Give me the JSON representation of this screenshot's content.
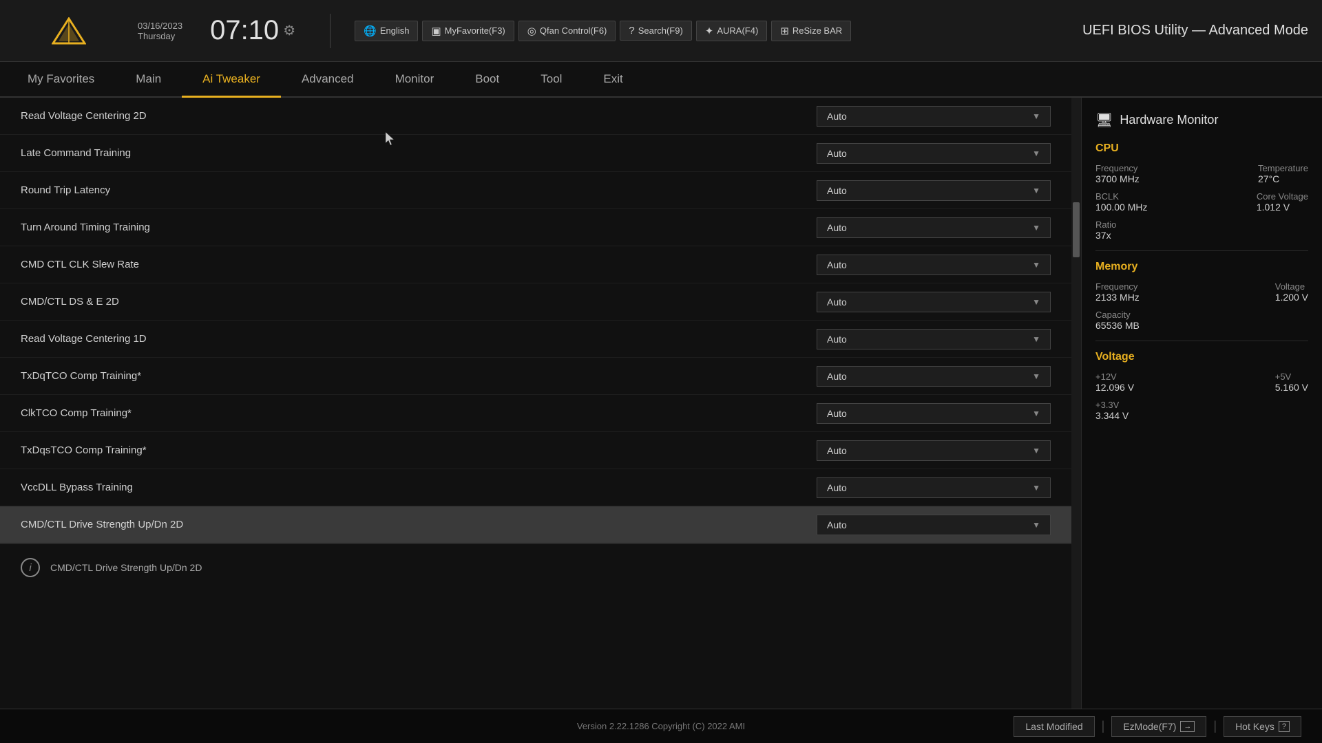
{
  "header": {
    "title": "UEFI BIOS Utility — Advanced Mode",
    "date": "03/16/2023",
    "day": "Thursday",
    "time": "07:10",
    "settings_icon": "⚙",
    "logo_alt": "ASUS"
  },
  "toolbar": {
    "items": [
      {
        "id": "language",
        "icon": "🌐",
        "label": "English"
      },
      {
        "id": "myfavorite",
        "icon": "★",
        "label": "MyFavorite(F3)"
      },
      {
        "id": "qfan",
        "icon": "◎",
        "label": "Qfan Control(F6)"
      },
      {
        "id": "search",
        "icon": "?",
        "label": "Search(F9)"
      },
      {
        "id": "aura",
        "icon": "✦",
        "label": "AURA(F4)"
      },
      {
        "id": "resizebar",
        "icon": "⊞",
        "label": "ReSize BAR"
      }
    ]
  },
  "nav": {
    "items": [
      {
        "id": "my-favorites",
        "label": "My Favorites",
        "active": false
      },
      {
        "id": "main",
        "label": "Main",
        "active": false
      },
      {
        "id": "ai-tweaker",
        "label": "Ai Tweaker",
        "active": true
      },
      {
        "id": "advanced",
        "label": "Advanced",
        "active": false
      },
      {
        "id": "monitor",
        "label": "Monitor",
        "active": false
      },
      {
        "id": "boot",
        "label": "Boot",
        "active": false
      },
      {
        "id": "tool",
        "label": "Tool",
        "active": false
      },
      {
        "id": "exit",
        "label": "Exit",
        "active": false
      }
    ]
  },
  "settings": {
    "rows": [
      {
        "id": "read-voltage-centering-2d",
        "name": "Read Voltage Centering 2D",
        "value": "Auto",
        "selected": false
      },
      {
        "id": "late-command-training",
        "name": "Late Command Training",
        "value": "Auto",
        "selected": false
      },
      {
        "id": "round-trip-latency",
        "name": "Round Trip Latency",
        "value": "Auto",
        "selected": false
      },
      {
        "id": "turn-around-timing-training",
        "name": "Turn Around Timing Training",
        "value": "Auto",
        "selected": false
      },
      {
        "id": "cmd-ctl-clk-slew-rate",
        "name": "CMD CTL CLK Slew Rate",
        "value": "Auto",
        "selected": false
      },
      {
        "id": "cmd-ctl-ds-e-2d",
        "name": "CMD/CTL DS & E 2D",
        "value": "Auto",
        "selected": false
      },
      {
        "id": "read-voltage-centering-1d",
        "name": "Read Voltage Centering 1D",
        "value": "Auto",
        "selected": false
      },
      {
        "id": "txdqtco-comp-training",
        "name": "TxDqTCO Comp Training*",
        "value": "Auto",
        "selected": false
      },
      {
        "id": "clktco-comp-training",
        "name": "ClkTCO Comp Training*",
        "value": "Auto",
        "selected": false
      },
      {
        "id": "txdqstco-comp-training",
        "name": "TxDqsTCO Comp Training*",
        "value": "Auto",
        "selected": false
      },
      {
        "id": "vccdll-bypass-training",
        "name": "VccDLL Bypass Training",
        "value": "Auto",
        "selected": false
      },
      {
        "id": "cmd-ctl-drive-strength-2d",
        "name": "CMD/CTL Drive Strength Up/Dn 2D",
        "value": "Auto",
        "selected": true
      }
    ],
    "info_text": "CMD/CTL Drive Strength Up/Dn 2D"
  },
  "hardware_monitor": {
    "title": "Hardware Monitor",
    "icon": "🖥",
    "cpu": {
      "title": "CPU",
      "frequency_label": "Frequency",
      "frequency_value": "3700 MHz",
      "temperature_label": "Temperature",
      "temperature_value": "27°C",
      "bclk_label": "BCLK",
      "bclk_value": "100.00 MHz",
      "core_voltage_label": "Core Voltage",
      "core_voltage_value": "1.012 V",
      "ratio_label": "Ratio",
      "ratio_value": "37x"
    },
    "memory": {
      "title": "Memory",
      "frequency_label": "Frequency",
      "frequency_value": "2133 MHz",
      "voltage_label": "Voltage",
      "voltage_value": "1.200 V",
      "capacity_label": "Capacity",
      "capacity_value": "65536 MB"
    },
    "voltage": {
      "title": "Voltage",
      "v12_label": "+12V",
      "v12_value": "12.096 V",
      "v5_label": "+5V",
      "v5_value": "5.160 V",
      "v33_label": "+3.3V",
      "v33_value": "3.344 V"
    }
  },
  "footer": {
    "version": "Version 2.22.1286 Copyright (C) 2022 AMI",
    "last_modified": "Last Modified",
    "ez_mode": "EzMode(F7)",
    "hot_keys": "Hot Keys"
  }
}
